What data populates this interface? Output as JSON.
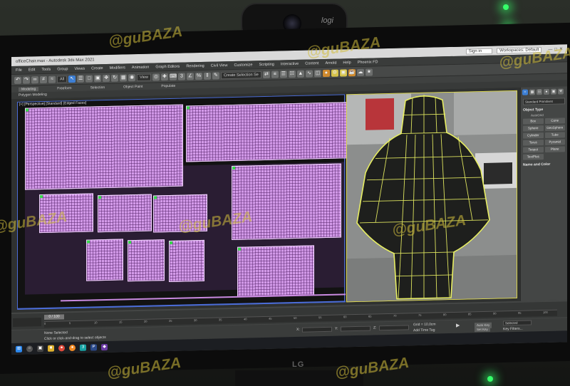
{
  "webcam": {
    "brand": "logi"
  },
  "monitor": {
    "brand": "LG"
  },
  "window": {
    "title": "officeChair.max - Autodesk 3ds Max 2021",
    "signin": "Sign in",
    "workspace": "Workspaces: Default"
  },
  "menu": [
    "File",
    "Edit",
    "Tools",
    "Group",
    "Views",
    "Create",
    "Modifiers",
    "Animation",
    "Graph Editors",
    "Rendering",
    "Civil View",
    "Customize",
    "Scripting",
    "Interactive",
    "Content",
    "Arnold",
    "Help",
    "Phoenix FD"
  ],
  "toolbar": {
    "filter": "All",
    "view": "View",
    "selection_set": "Create Selection Se"
  },
  "ribbon": {
    "tabs": [
      "Modeling",
      "Freeform",
      "Selection",
      "Object Paint",
      "Populate"
    ],
    "sub": "Polygon Modeling"
  },
  "viewport_left": {
    "label": "[+] [Perspective] [Standard] [Edged Faces]"
  },
  "command_panel": {
    "dropdown": "Standard Primitives",
    "section_object_type": "Object Type",
    "autogrid": "AutoGrid",
    "buttons": [
      "Box",
      "Cone",
      "Sphere",
      "GeoSphere",
      "Cylinder",
      "Tube",
      "Torus",
      "Pyramid",
      "Teapot",
      "Plane",
      "TextPlus"
    ],
    "section_name_color": "Name and Color"
  },
  "timeline": {
    "slider": "0 / 100",
    "ticks": [
      "0",
      "5",
      "10",
      "15",
      "20",
      "25",
      "30",
      "35",
      "40",
      "45",
      "50",
      "55",
      "60",
      "65",
      "70",
      "75",
      "80",
      "85",
      "90",
      "95",
      "100"
    ]
  },
  "status": {
    "prompt": "None Selected",
    "hint": "Click or click-and-drag to select objects",
    "x_label": "X:",
    "y_label": "Y:",
    "z_label": "Z:",
    "grid": "Grid = 10,0cm",
    "add_time_tag": "Add Time Tag",
    "auto_key": "Auto Key",
    "set_key": "Set Key",
    "selected": "Selected",
    "key_filters": "Key Filters..."
  },
  "watermark": "@guBAZA"
}
